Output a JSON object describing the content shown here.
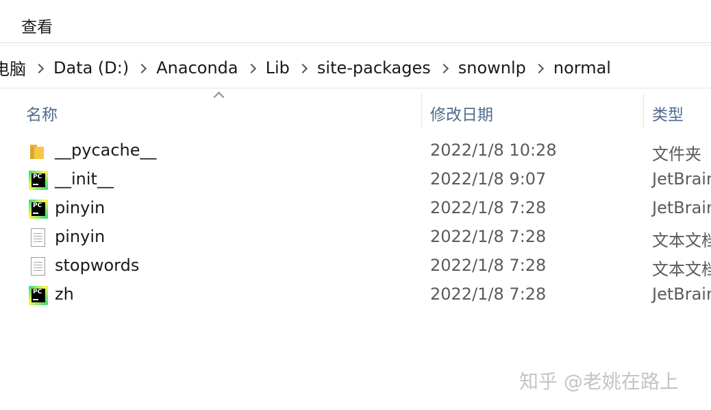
{
  "menu": {
    "view_label": "查看"
  },
  "breadcrumb": [
    {
      "label": "电脑"
    },
    {
      "label": "Data (D:)"
    },
    {
      "label": "Anaconda"
    },
    {
      "label": "Lib"
    },
    {
      "label": "site-packages"
    },
    {
      "label": "snownlp"
    },
    {
      "label": "normal"
    }
  ],
  "columns": {
    "name": "名称",
    "date": "修改日期",
    "type": "类型"
  },
  "files": [
    {
      "icon": "folder-icon",
      "name": "__pycache__",
      "date": "2022/1/8 10:28",
      "type": "文件夹"
    },
    {
      "icon": "pycharm-file-icon",
      "name": "__init__",
      "date": "2022/1/8 9:07",
      "type": "JetBrain"
    },
    {
      "icon": "pycharm-file-icon",
      "name": "pinyin",
      "date": "2022/1/8 7:28",
      "type": "JetBrain"
    },
    {
      "icon": "text-file-icon",
      "name": "pinyin",
      "date": "2022/1/8 7:28",
      "type": "文本文档"
    },
    {
      "icon": "text-file-icon",
      "name": "stopwords",
      "date": "2022/1/8 7:28",
      "type": "文本文档"
    },
    {
      "icon": "pycharm-file-icon",
      "name": "zh",
      "date": "2022/1/8 7:28",
      "type": "JetBrain"
    }
  ],
  "watermark": "知乎 @老姚在路上"
}
